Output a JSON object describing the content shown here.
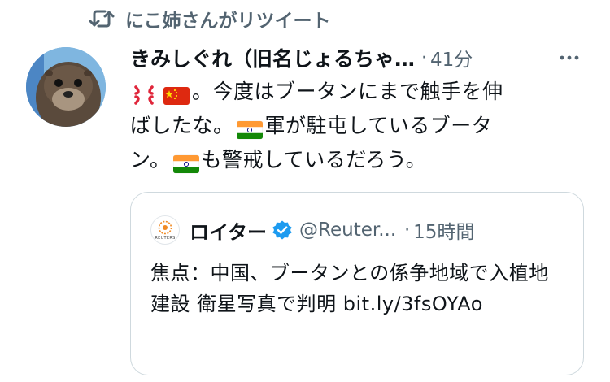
{
  "retweet": {
    "text": "にこ姉さんがリツイート",
    "icon": "retweet-icon"
  },
  "tweet": {
    "author_name": "きみしぐれ（旧名じょるちゃ…",
    "separator": "·",
    "time": "41分",
    "emojis": [
      "anger-symbol",
      "flag-china",
      "flag-india",
      "flag-india"
    ],
    "text_line1": "。今度はブータンにまで触手を伸",
    "text_line2": "ばしたな。",
    "text_line2b": "軍が駐屯しているブータ",
    "text_line3": "ン。",
    "text_line3b": "も警戒しているだろう。"
  },
  "quote": {
    "logo_text": "REUTERS",
    "name": "ロイター",
    "handle": "@Reuter...",
    "separator": "·",
    "time": "15時間",
    "body": "焦点：中国、ブータンとの係争地域で入植地建設 衛星写真で判明 bit.ly/3fsOYAo"
  },
  "colors": {
    "text": "#0f1419",
    "muted": "#536471",
    "border": "#cfd9de",
    "verified": "#1d9bf0"
  }
}
